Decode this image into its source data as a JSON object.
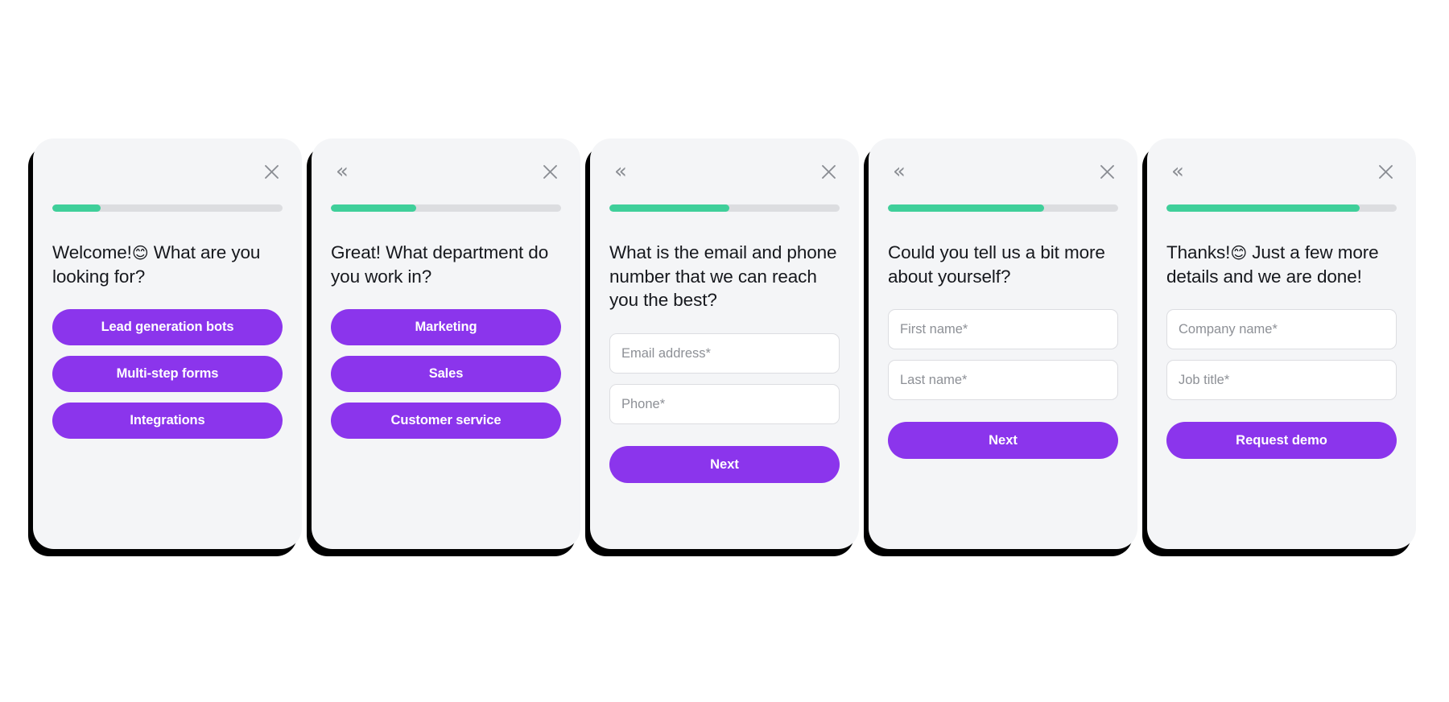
{
  "screen": {
    "title": "Multi-step lead generation form flow",
    "background_color": "#ffffff"
  },
  "theme": {
    "card_background": "#f4f5f7",
    "shadow_color": "#000000",
    "accent_purple": "#8b35ec",
    "progress_green": "#3fcf9a",
    "progress_track": "#dcdde0",
    "text_color": "#16181d",
    "placeholder_color": "#8d9096",
    "icon_color": "#8a8d93"
  },
  "icons": {
    "close": "close-icon",
    "back": "«"
  },
  "cards": [
    {
      "step": 1,
      "progress_percent": 21,
      "has_back": false,
      "question": "Welcome!",
      "emoji": "😊",
      "question_rest": " What are you looking for?",
      "type": "choices",
      "choices": [
        {
          "label": "Lead generation bots"
        },
        {
          "label": "Multi-step forms"
        },
        {
          "label": "Integrations"
        }
      ],
      "inputs": [],
      "submit": null
    },
    {
      "step": 2,
      "progress_percent": 37,
      "has_back": true,
      "question": "Great! What department do you work in?",
      "emoji": "",
      "question_rest": "",
      "type": "choices",
      "choices": [
        {
          "label": "Marketing"
        },
        {
          "label": "Sales"
        },
        {
          "label": "Customer service"
        }
      ],
      "inputs": [],
      "submit": null
    },
    {
      "step": 3,
      "progress_percent": 52,
      "has_back": true,
      "question": "What is the email and phone number that we can reach you the best?",
      "emoji": "",
      "question_rest": "",
      "type": "form",
      "choices": [],
      "inputs": [
        {
          "placeholder": "Email address*",
          "value": ""
        },
        {
          "placeholder": "Phone*",
          "value": ""
        }
      ],
      "submit": "Next"
    },
    {
      "step": 4,
      "progress_percent": 68,
      "has_back": true,
      "question": "Could you tell us a bit more about yourself?",
      "emoji": "",
      "question_rest": "",
      "type": "form",
      "choices": [],
      "inputs": [
        {
          "placeholder": "First name*",
          "value": ""
        },
        {
          "placeholder": "Last name*",
          "value": ""
        }
      ],
      "submit": "Next"
    },
    {
      "step": 5,
      "progress_percent": 84,
      "has_back": true,
      "question": "Thanks!",
      "emoji": "😊",
      "question_rest": " Just a few more details and we are done!",
      "type": "form",
      "choices": [],
      "inputs": [
        {
          "placeholder": "Company name*",
          "value": ""
        },
        {
          "placeholder": "Job title*",
          "value": ""
        }
      ],
      "submit": "Request demo"
    }
  ]
}
